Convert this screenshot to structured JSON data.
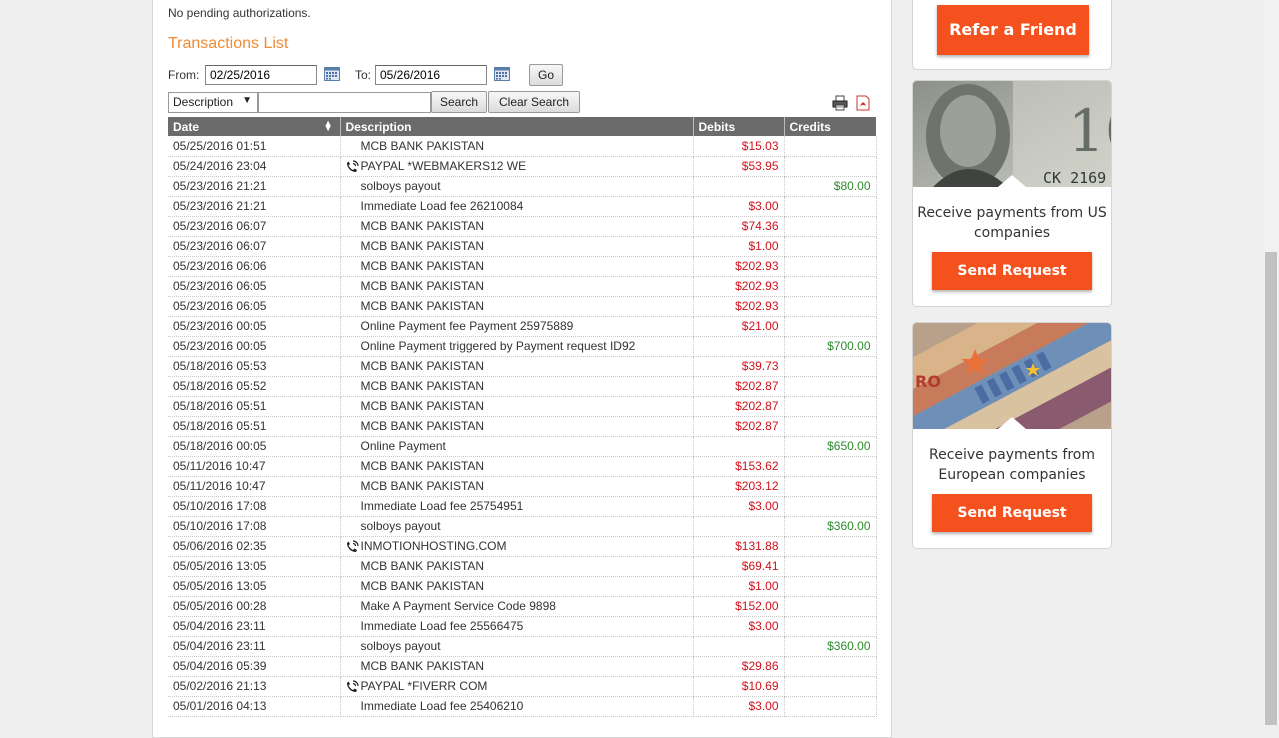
{
  "pending_text": "No pending authorizations.",
  "section_title": "Transactions List",
  "filter": {
    "from_label": "From:",
    "from_value": "02/25/2016",
    "to_label": "To:",
    "to_value": "05/26/2016",
    "go_label": "Go"
  },
  "search": {
    "field_selected": "Description",
    "query": "",
    "search_label": "Search",
    "clear_label": "Clear Search"
  },
  "columns": [
    "Date",
    "Description",
    "Debits",
    "Credits"
  ],
  "rows": [
    {
      "date": "05/25/2016 01:51",
      "desc": "MCB BANK PAKISTAN",
      "debit": "$15.03",
      "credit": "",
      "phone": false
    },
    {
      "date": "05/24/2016 23:04",
      "desc": "PAYPAL *WEBMAKERS12 WE",
      "debit": "$53.95",
      "credit": "",
      "phone": true
    },
    {
      "date": "05/23/2016 21:21",
      "desc": "solboys payout",
      "debit": "",
      "credit": "$80.00",
      "phone": false
    },
    {
      "date": "05/23/2016 21:21",
      "desc": "Immediate Load fee 26210084",
      "debit": "$3.00",
      "credit": "",
      "phone": false
    },
    {
      "date": "05/23/2016 06:07",
      "desc": "MCB BANK PAKISTAN",
      "debit": "$74.36",
      "credit": "",
      "phone": false
    },
    {
      "date": "05/23/2016 06:07",
      "desc": "MCB BANK PAKISTAN",
      "debit": "$1.00",
      "credit": "",
      "phone": false
    },
    {
      "date": "05/23/2016 06:06",
      "desc": "MCB BANK PAKISTAN",
      "debit": "$202.93",
      "credit": "",
      "phone": false
    },
    {
      "date": "05/23/2016 06:05",
      "desc": "MCB BANK PAKISTAN",
      "debit": "$202.93",
      "credit": "",
      "phone": false
    },
    {
      "date": "05/23/2016 06:05",
      "desc": "MCB BANK PAKISTAN",
      "debit": "$202.93",
      "credit": "",
      "phone": false
    },
    {
      "date": "05/23/2016 00:05",
      "desc": "Online Payment fee Payment 25975889",
      "debit": "$21.00",
      "credit": "",
      "phone": false
    },
    {
      "date": "05/23/2016 00:05",
      "desc": "Online Payment triggered by Payment request ID92",
      "debit": "",
      "credit": "$700.00",
      "phone": false
    },
    {
      "date": "05/18/2016 05:53",
      "desc": "MCB BANK PAKISTAN",
      "debit": "$39.73",
      "credit": "",
      "phone": false
    },
    {
      "date": "05/18/2016 05:52",
      "desc": "MCB BANK PAKISTAN",
      "debit": "$202.87",
      "credit": "",
      "phone": false
    },
    {
      "date": "05/18/2016 05:51",
      "desc": "MCB BANK PAKISTAN",
      "debit": "$202.87",
      "credit": "",
      "phone": false
    },
    {
      "date": "05/18/2016 05:51",
      "desc": "MCB BANK PAKISTAN",
      "debit": "$202.87",
      "credit": "",
      "phone": false
    },
    {
      "date": "05/18/2016 00:05",
      "desc": "Online Payment",
      "debit": "",
      "credit": "$650.00",
      "phone": false
    },
    {
      "date": "05/11/2016 10:47",
      "desc": "MCB BANK PAKISTAN",
      "debit": "$153.62",
      "credit": "",
      "phone": false
    },
    {
      "date": "05/11/2016 10:47",
      "desc": "MCB BANK PAKISTAN",
      "debit": "$203.12",
      "credit": "",
      "phone": false
    },
    {
      "date": "05/10/2016 17:08",
      "desc": "Immediate Load fee 25754951",
      "debit": "$3.00",
      "credit": "",
      "phone": false
    },
    {
      "date": "05/10/2016 17:08",
      "desc": "solboys payout",
      "debit": "",
      "credit": "$360.00",
      "phone": false
    },
    {
      "date": "05/06/2016 02:35",
      "desc": "INMOTIONHOSTING.COM",
      "debit": "$131.88",
      "credit": "",
      "phone": true
    },
    {
      "date": "05/05/2016 13:05",
      "desc": "MCB BANK PAKISTAN",
      "debit": "$69.41",
      "credit": "",
      "phone": false
    },
    {
      "date": "05/05/2016 13:05",
      "desc": "MCB BANK PAKISTAN",
      "debit": "$1.00",
      "credit": "",
      "phone": false
    },
    {
      "date": "05/05/2016 00:28",
      "desc": "Make A Payment Service Code 9898",
      "debit": "$152.00",
      "credit": "",
      "phone": false
    },
    {
      "date": "05/04/2016 23:11",
      "desc": "Immediate Load fee 25566475",
      "debit": "$3.00",
      "credit": "",
      "phone": false
    },
    {
      "date": "05/04/2016 23:11",
      "desc": "solboys payout",
      "debit": "",
      "credit": "$360.00",
      "phone": false
    },
    {
      "date": "05/04/2016 05:39",
      "desc": "MCB BANK PAKISTAN",
      "debit": "$29.86",
      "credit": "",
      "phone": false
    },
    {
      "date": "05/02/2016 21:13",
      "desc": "PAYPAL *FIVERR COM",
      "debit": "$10.69",
      "credit": "",
      "phone": true
    },
    {
      "date": "05/01/2016 04:13",
      "desc": "Immediate Load fee 25406210",
      "debit": "$3.00",
      "credit": "",
      "phone": false
    }
  ],
  "sidebar": {
    "refer_label": "Refer a Friend",
    "us_card": {
      "text": "Receive payments from US companies",
      "button": "Send Request",
      "banknote_text": "CK 2169"
    },
    "eu_card": {
      "text": "Receive payments from European companies",
      "button": "Send Request",
      "banknote_text": "RO"
    }
  },
  "colors": {
    "accent": "#f08a34",
    "button": "#f5511e",
    "debit": "#d0101a",
    "credit": "#2f8a2f",
    "header": "#6b6b6b"
  }
}
